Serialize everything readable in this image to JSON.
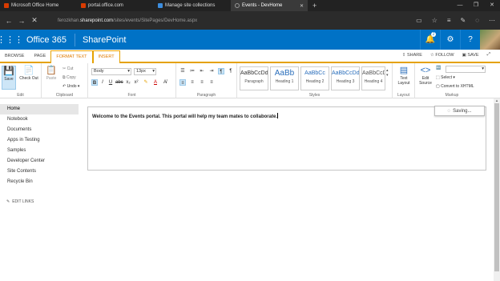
{
  "browser": {
    "tabs": [
      {
        "title": "Microsoft Office Home",
        "color": "#d83b01"
      },
      {
        "title": "portal.office.com",
        "color": "#d83b01"
      },
      {
        "title": "Manage site collections",
        "color": "#3c8dde"
      },
      {
        "title": "Events - DevHome",
        "color": "#8a8a8a"
      }
    ],
    "new_tab": "+",
    "window_controls": [
      "—",
      "❐",
      "✕"
    ],
    "url_prefix": "ferozkhan.",
    "url_domain": "sharepoint.com",
    "url_path": "/sites/events/SitePages/DevHome.aspx"
  },
  "suite": {
    "brand": "Office 365",
    "app": "SharePoint",
    "notification_count": "1",
    "waffle_icon": "waffle-icon"
  },
  "ribbon_tabs": {
    "browse": "BROWSE",
    "page": "PAGE",
    "format_text": "FORMAT TEXT",
    "insert": "INSERT"
  },
  "ribbon_actions": {
    "share": "SHARE",
    "follow": "FOLLOW",
    "save": "SAVE"
  },
  "ribbon": {
    "edit": {
      "save": "Save",
      "checkout": "Check Out",
      "label": "Edit"
    },
    "clipboard": {
      "paste": "Paste",
      "cut": "Cut",
      "copy": "Copy",
      "undo": "Undo",
      "label": "Clipboard"
    },
    "font": {
      "family": "Body",
      "size": "13px",
      "label": "Font"
    },
    "paragraph": {
      "label": "Paragraph"
    },
    "styles": {
      "items": [
        {
          "preview": "AaBbCcDdI",
          "name": "Paragraph"
        },
        {
          "preview": "AaBb",
          "name": "Heading 1"
        },
        {
          "preview": "AaBbCc",
          "name": "Heading 2"
        },
        {
          "preview": "AaBbCcDd",
          "name": "Heading 3"
        },
        {
          "preview": "AaBbCcDd",
          "name": "Heading 4"
        }
      ],
      "label": "Styles"
    },
    "layout": {
      "text_layout": "Text Layout",
      "label": "Layout"
    },
    "markup": {
      "edit_source": "Edit Source",
      "select": "Select",
      "convert": "Convert to XHTML",
      "label": "Markup"
    }
  },
  "nav": {
    "items": [
      "Home",
      "Notebook",
      "Documents",
      "Apps in Testing",
      "Samples",
      "Developer Center",
      "Site Contents",
      "Recycle Bin"
    ],
    "edit_links": "EDIT LINKS"
  },
  "editor": {
    "content": "Welcome to the Events portal. This portal will help my team mates to collaborate."
  },
  "status": {
    "saving": "Saving..."
  }
}
